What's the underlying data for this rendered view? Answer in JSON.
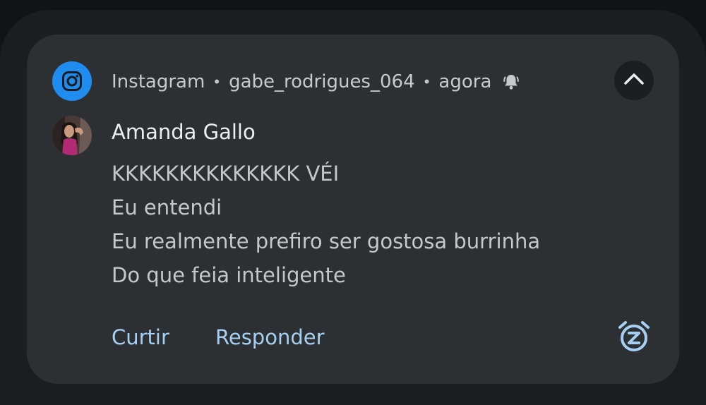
{
  "notification": {
    "app_name": "Instagram",
    "separator": "•",
    "account": "gabe_rodrigues_064",
    "time": "agora",
    "app_icon": "instagram-icon",
    "alert_icon": "bell-icon",
    "expand_icon": "chevron-up-icon",
    "sender": "Amanda Gallo",
    "messages": [
      "KKKKKKKKKKKKKK VÉI",
      "Eu entendi",
      "Eu realmente prefiro ser gostosa burrinha",
      "Do que feia inteligente"
    ],
    "actions": {
      "like": "Curtir",
      "reply": "Responder"
    },
    "snooze_icon": "snooze-alarm-icon"
  },
  "colors": {
    "card_background": "#2d3032",
    "instagram_blue": "#1f8df0",
    "action_text": "#a6d0f3"
  }
}
